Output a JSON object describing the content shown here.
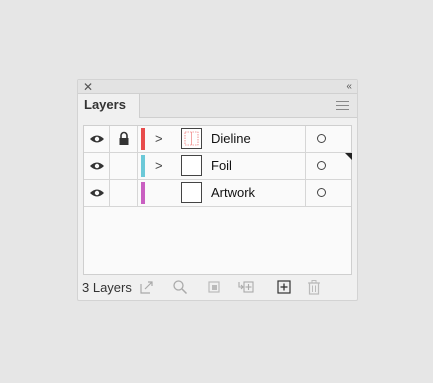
{
  "panel": {
    "close_glyph": "✕",
    "collapse_glyph": "‹‹",
    "tab_label": "Layers",
    "menu_icon": "hamburger-menu-icon"
  },
  "layers": [
    {
      "name": "Dieline",
      "visible": true,
      "locked": true,
      "color": "#e84c4c",
      "expandable": true,
      "thumbnail": "dieline-thumbnail"
    },
    {
      "name": "Foil",
      "visible": true,
      "locked": false,
      "color": "#6cc9d8",
      "expandable": true,
      "thumbnail": "blank-thumbnail",
      "selected_indicator": true
    },
    {
      "name": "Artwork",
      "visible": true,
      "locked": false,
      "color": "#c95fc1",
      "expandable": false,
      "thumbnail": "blank-thumbnail"
    }
  ],
  "footer": {
    "layer_count": "3 Layers",
    "icons": [
      "export-icon",
      "search-icon",
      "clipping-mask-icon",
      "new-sublayer-icon",
      "new-layer-icon",
      "trash-icon"
    ]
  },
  "colors": {
    "background": "#e6e6e6",
    "panel": "#f0f0f0",
    "list": "#fafafa"
  }
}
